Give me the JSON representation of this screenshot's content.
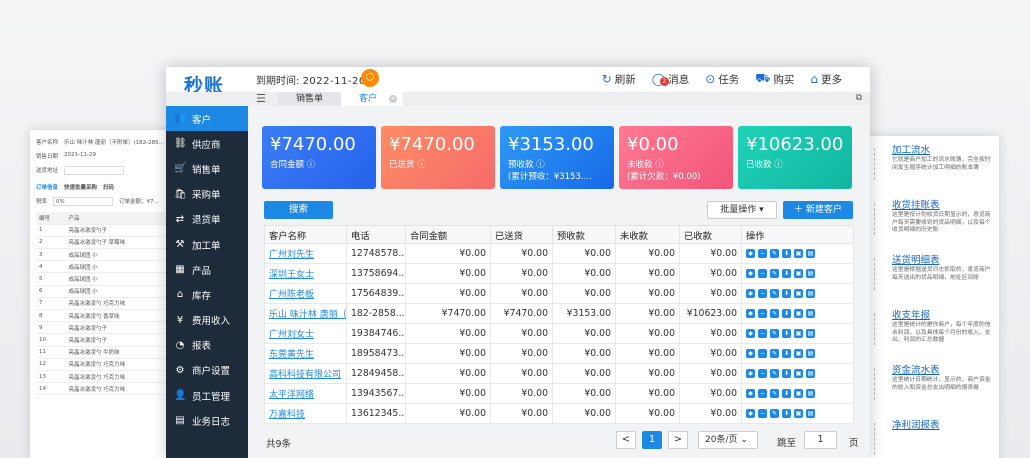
{
  "bg_left": {
    "customer_label": "客户名称",
    "customer_value": "乐山 味汁林 唐丽（不附单）(182-285...",
    "date_label": "销售日期",
    "date_value": "2021-11-29",
    "address_label": "送货地址",
    "order_info": "订单信息",
    "quick_add": "快速批量采购",
    "scan": "扫码",
    "tax_label": "税率",
    "tax_value": "0%",
    "order_amount": "订单金额：¥7...",
    "cols": [
      "编号",
      "产品"
    ],
    "rows": [
      [
        "1",
        "亮晶冰激凌勺子"
      ],
      [
        "2",
        "亮晶冰激凌勺子 草莓味"
      ],
      [
        "3",
        "成品球团 小"
      ],
      [
        "4",
        "成品球团 小"
      ],
      [
        "5",
        "成品球团 小"
      ],
      [
        "6",
        "成品球团 小"
      ],
      [
        "7",
        "亮晶冰激凌勺 巧克力味"
      ],
      [
        "8",
        "亮晶冰激凌勺 香草味"
      ],
      [
        "9",
        "亮晶冰激凌勺子"
      ],
      [
        "10",
        "亮晶冰激凌勺子"
      ],
      [
        "11",
        "亮晶冰激凌勺 牛奶味"
      ],
      [
        "12",
        "亮晶冰激凌勺 巧克力味"
      ],
      [
        "13",
        "亮晶冰激凌勺 巧克力味"
      ],
      [
        "14",
        "亮晶冰激凌勺 巧克力味"
      ]
    ]
  },
  "bg_right": [
    {
      "title": "加工流水",
      "desc": "它就是商户加工的流水账簿，完全按时间发生顺序统计加工明细的账本簿"
    },
    {
      "title": "收货挂账表",
      "desc": "这里是按计划收货日期显示的，息览商户每天需要收到的货品明细，以及每个收货明细的历史账"
    },
    {
      "title": "送货明细表",
      "desc": "这里是根据送货日志抓取的，息览商户每天送出的货品明细，地址区间账"
    },
    {
      "title": "收支年报",
      "desc": "这里是统计的是你商户，每个年度的信余利润，以及具体每个月份的收入、支出、利润的汇总数据"
    },
    {
      "title": "资金流水表",
      "desc": "这里统计日期统计，显示的，商户资金的收入和资金总支出明细的报表概"
    },
    {
      "title": "净利润报表",
      "desc": ""
    }
  ],
  "header": {
    "logo": "秒账",
    "expire_label": "到期时间:",
    "expire_date": "2022-11-20",
    "actions": [
      {
        "icon": "refresh-icon",
        "glyph": "↻",
        "label": "刷新"
      },
      {
        "icon": "message-icon",
        "glyph": "◯",
        "label": "消息",
        "badge": "2"
      },
      {
        "icon": "task-icon",
        "glyph": "⊙",
        "label": "任务"
      },
      {
        "icon": "cart-icon",
        "glyph": "⛟",
        "label": "购买"
      },
      {
        "icon": "more-icon",
        "glyph": "⌂",
        "label": "更多"
      }
    ],
    "tabs": [
      "销售单",
      "客户"
    ]
  },
  "sidebar": [
    {
      "icon": "customer-icon",
      "glyph": "👥",
      "label": "客户"
    },
    {
      "icon": "supplier-icon",
      "glyph": "⛓",
      "label": "供应商"
    },
    {
      "icon": "sales-icon",
      "glyph": "🛒",
      "label": "销售单"
    },
    {
      "icon": "purchase-icon",
      "glyph": "🛍",
      "label": "采购单"
    },
    {
      "icon": "return-icon",
      "glyph": "⇄",
      "label": "退货单"
    },
    {
      "icon": "process-icon",
      "glyph": "⚒",
      "label": "加工单"
    },
    {
      "icon": "product-icon",
      "glyph": "▦",
      "label": "产品"
    },
    {
      "icon": "stock-icon",
      "glyph": "⌂",
      "label": "库存"
    },
    {
      "icon": "expense-icon",
      "glyph": "¥",
      "label": "费用收入"
    },
    {
      "icon": "report-icon",
      "glyph": "◔",
      "label": "报表"
    },
    {
      "icon": "settings-icon",
      "glyph": "⚙",
      "label": "商户设置"
    },
    {
      "icon": "staff-icon",
      "glyph": "👤",
      "label": "员工管理"
    },
    {
      "icon": "log-icon",
      "glyph": "▤",
      "label": "业务日志"
    }
  ],
  "stats": [
    {
      "value": "¥7470.00",
      "label": "合同金额 ⓘ",
      "sub": ""
    },
    {
      "value": "¥7470.00",
      "label": "已送货 ⓘ",
      "sub": ""
    },
    {
      "value": "¥3153.00",
      "label": "预收款 ⓘ",
      "sub": "(累计预收：¥3153...."
    },
    {
      "value": "¥0.00",
      "label": "未收款 ⓘ",
      "sub": "(累计欠款：¥0.00)"
    },
    {
      "value": "¥10623.00",
      "label": "已收款 ⓘ",
      "sub": ""
    }
  ],
  "toolbar": {
    "search": "搜索",
    "batch": "批量操作 ▾",
    "add": "＋ 新建客户"
  },
  "table": {
    "cols": [
      "客户名称",
      "电话",
      "合同金额",
      "已送货",
      "预收款",
      "未收款",
      "已收款",
      "操作"
    ],
    "rows": [
      [
        "广州刘先生",
        "12748578...",
        "¥0.00",
        "¥0.00",
        "¥0.00",
        "¥0.00",
        "¥0.00"
      ],
      [
        "深圳王女士",
        "13758694...",
        "¥0.00",
        "¥0.00",
        "¥0.00",
        "¥0.00",
        "¥0.00"
      ],
      [
        "广州陈老板",
        "17564839...",
        "¥0.00",
        "¥0.00",
        "¥0.00",
        "¥0.00",
        "¥0.00"
      ],
      [
        "乐山 味汁林 唐丽（",
        "182-2858...",
        "¥7470.00",
        "¥7470.00",
        "¥3153.00",
        "¥0.00",
        "¥10623.00"
      ],
      [
        "广州刘女士",
        "19384746...",
        "¥0.00",
        "¥0.00",
        "¥0.00",
        "¥0.00",
        "¥0.00"
      ],
      [
        "东莞黄先生",
        "18958473...",
        "¥0.00",
        "¥0.00",
        "¥0.00",
        "¥0.00",
        "¥0.00"
      ],
      [
        "高科科技有限公司",
        "12849458...",
        "¥0.00",
        "¥0.00",
        "¥0.00",
        "¥0.00",
        "¥0.00"
      ],
      [
        "太平洋网络",
        "13943567...",
        "¥0.00",
        "¥0.00",
        "¥0.00",
        "¥0.00",
        "¥0.00"
      ],
      [
        "万嘉科技",
        "13612345...",
        "¥0.00",
        "¥0.00",
        "¥0.00",
        "¥0.00",
        "¥0.00"
      ]
    ]
  },
  "pager": {
    "total": "共9条",
    "prev": "<",
    "page": "1",
    "next": ">",
    "size": "20条/页 ⌄",
    "jump": "跳至",
    "jump_value": "1",
    "unit": "页"
  }
}
